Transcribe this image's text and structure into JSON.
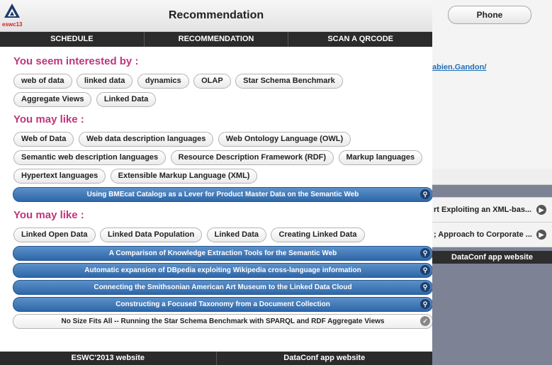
{
  "background_app": {
    "phone_button": "Phone",
    "link": "abien.Gandon/",
    "list_items": [
      "rt Exploiting an XML-bas...",
      "; Approach to Corporate ..."
    ],
    "footer": "DataConf app website"
  },
  "header": {
    "logo_text": "eswc13",
    "title": "Recommendation"
  },
  "nav": {
    "tabs": [
      "SCHEDULE",
      "RECOMMENDATION",
      "SCAN A QRCODE"
    ]
  },
  "sections": [
    {
      "heading": "You seem interested by :",
      "chips": [
        "web of data",
        "linked data",
        "dynamics",
        "OLAP",
        "Star Schema Benchmark",
        "Aggregate Views",
        "Linked Data"
      ],
      "papers": []
    },
    {
      "heading": "You may like :",
      "chips": [
        "Web of Data",
        "Web data description languages",
        "Web Ontology Language (OWL)",
        "Semantic web description languages",
        "Resource Description Framework (RDF)",
        "Markup languages",
        "Hypertext languages",
        "Extensible Markup Language (XML)"
      ],
      "papers": [
        "Using BMEcat Catalogs as a Lever for Product Master Data on the Semantic Web"
      ]
    },
    {
      "heading": "You may like :",
      "chips": [
        "Linked Open Data",
        "Linked Data Population",
        "Linked Data",
        "Creating Linked Data"
      ],
      "papers": [
        "A Comparison of Knowledge Extraction Tools for the Semantic Web",
        "Automatic expansion of DBpedia exploiting Wikipedia cross-language information",
        "Connecting the Smithsonian American Art Museum to the Linked Data Cloud",
        "Constructing a Focused Taxonomy from a Document Collection",
        "No Size Fits All -- Running the Star Schema Benchmark with SPARQL and RDF Aggregate Views"
      ]
    }
  ],
  "footer": {
    "links": [
      "ESWC'2013 website",
      "DataConf app website"
    ]
  },
  "colors": {
    "heading": "#c0357c",
    "bar_blue": "#2f67a8",
    "navbar": "#2b2b2b"
  }
}
